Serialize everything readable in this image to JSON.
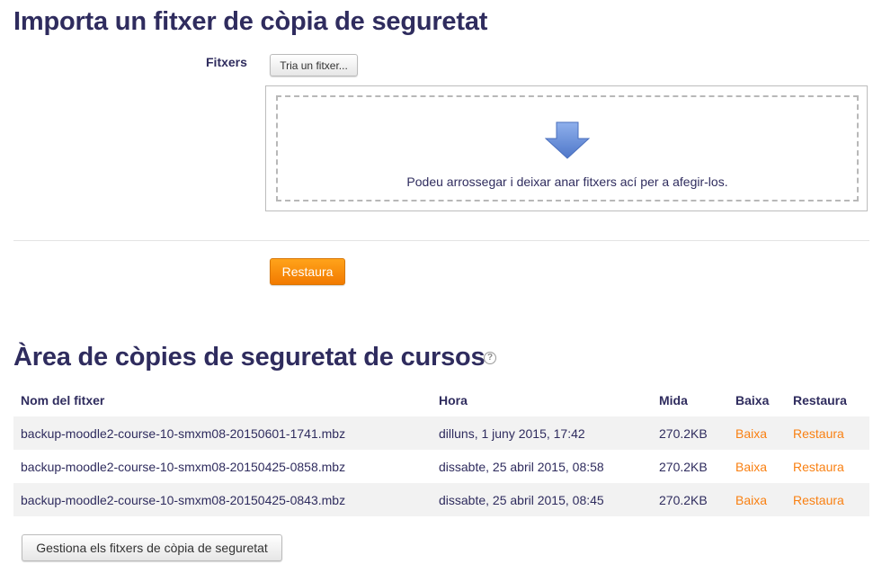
{
  "import": {
    "title": "Importa un fitxer de còpia de seguretat",
    "files_label": "Fitxers",
    "choose_button": "Tria un fitxer...",
    "drop_text": "Podeu arrossegar i deixar anar fitxers ací per a afegir-los.",
    "restore_button": "Restaura"
  },
  "backup_area": {
    "title": "Àrea de còpies de seguretat de cursos",
    "help_icon": "help-icon",
    "columns": {
      "name": "Nom del fitxer",
      "time": "Hora",
      "size": "Mida",
      "download": "Baixa",
      "restore": "Restaura"
    },
    "rows": [
      {
        "name": "backup-moodle2-course-10-smxm08-20150601-1741.mbz",
        "time": "dilluns, 1 juny 2015, 17:42",
        "size": "270.2KB",
        "download": "Baixa",
        "restore": "Restaura"
      },
      {
        "name": "backup-moodle2-course-10-smxm08-20150425-0858.mbz",
        "time": "dissabte, 25 abril 2015, 08:58",
        "size": "270.2KB",
        "download": "Baixa",
        "restore": "Restaura"
      },
      {
        "name": "backup-moodle2-course-10-smxm08-20150425-0843.mbz",
        "time": "dissabte, 25 abril 2015, 08:45",
        "size": "270.2KB",
        "download": "Baixa",
        "restore": "Restaura"
      }
    ],
    "manage_button": "Gestiona els fitxers de còpia de seguretat"
  },
  "colors": {
    "heading": "#2f2c5e",
    "link": "#f98012",
    "primary_button": "#f98012",
    "arrow": "#6d93d9"
  }
}
